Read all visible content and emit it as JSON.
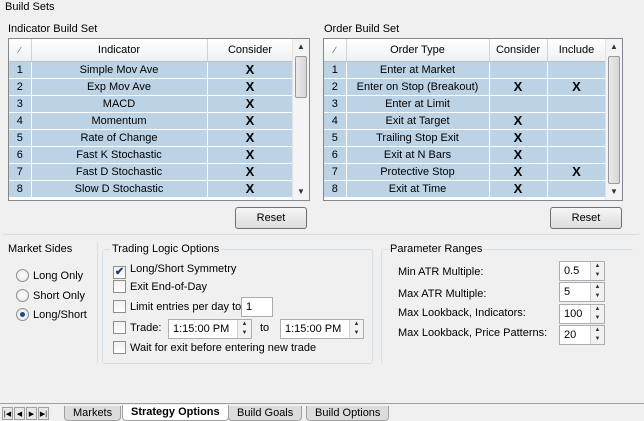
{
  "build_sets": {
    "title": "Build Sets",
    "indicator": {
      "label": "Indicator Build Set",
      "columns": [
        "",
        "Indicator",
        "Consider"
      ],
      "rows": [
        {
          "num": "1",
          "name": "Simple Mov Ave",
          "consider": "X"
        },
        {
          "num": "2",
          "name": "Exp Mov Ave",
          "consider": "X"
        },
        {
          "num": "3",
          "name": "MACD",
          "consider": "X"
        },
        {
          "num": "4",
          "name": "Momentum",
          "consider": "X"
        },
        {
          "num": "5",
          "name": "Rate of Change",
          "consider": "X"
        },
        {
          "num": "6",
          "name": "Fast K Stochastic",
          "consider": "X"
        },
        {
          "num": "7",
          "name": "Fast D Stochastic",
          "consider": "X"
        },
        {
          "num": "8",
          "name": "Slow D Stochastic",
          "consider": "X"
        }
      ],
      "reset_label": "Reset"
    },
    "order": {
      "label": "Order Build Set",
      "columns": [
        "",
        "Order Type",
        "Consider",
        "Include"
      ],
      "rows": [
        {
          "num": "1",
          "name": "Enter at Market",
          "consider": "",
          "include": ""
        },
        {
          "num": "2",
          "name": "Enter on Stop (Breakout)",
          "consider": "X",
          "include": "X"
        },
        {
          "num": "3",
          "name": "Enter at Limit",
          "consider": "",
          "include": ""
        },
        {
          "num": "4",
          "name": "Exit at Target",
          "consider": "X",
          "include": ""
        },
        {
          "num": "5",
          "name": "Trailing Stop Exit",
          "consider": "X",
          "include": ""
        },
        {
          "num": "6",
          "name": "Exit at N Bars",
          "consider": "X",
          "include": ""
        },
        {
          "num": "7",
          "name": "Protective Stop",
          "consider": "X",
          "include": "X"
        },
        {
          "num": "8",
          "name": "Exit at Time",
          "consider": "X",
          "include": ""
        }
      ],
      "reset_label": "Reset"
    }
  },
  "market_sides": {
    "title": "Market Sides",
    "options": [
      "Long Only",
      "Short Only",
      "Long/Short"
    ],
    "selected": 2
  },
  "trading_logic": {
    "title": "Trading Logic Options",
    "symmetry_label": "Long/Short Symmetry",
    "exit_eod_label": "Exit End-of-Day",
    "limit_entries_label": "Limit entries per day to",
    "limit_entries_value": "1",
    "trade_label": "Trade:",
    "trade_from": "1:15:00 PM",
    "to_label": "to",
    "trade_to": "1:15:00 PM",
    "wait_exit_label": "Wait for exit before entering new trade",
    "check_mark": "✔"
  },
  "parameter_ranges": {
    "title": "Parameter Ranges",
    "items": [
      {
        "label": "Min ATR Multiple:",
        "value": "0.5"
      },
      {
        "label": "Max ATR Multiple:",
        "value": "5"
      },
      {
        "label": "Max Lookback, Indicators:",
        "value": "100"
      },
      {
        "label": "Max Lookback, Price Patterns:",
        "value": "20"
      }
    ]
  },
  "tabs": [
    "Markets",
    "Strategy Options",
    "Build Goals",
    "Build Options"
  ],
  "active_tab": "Strategy Options"
}
